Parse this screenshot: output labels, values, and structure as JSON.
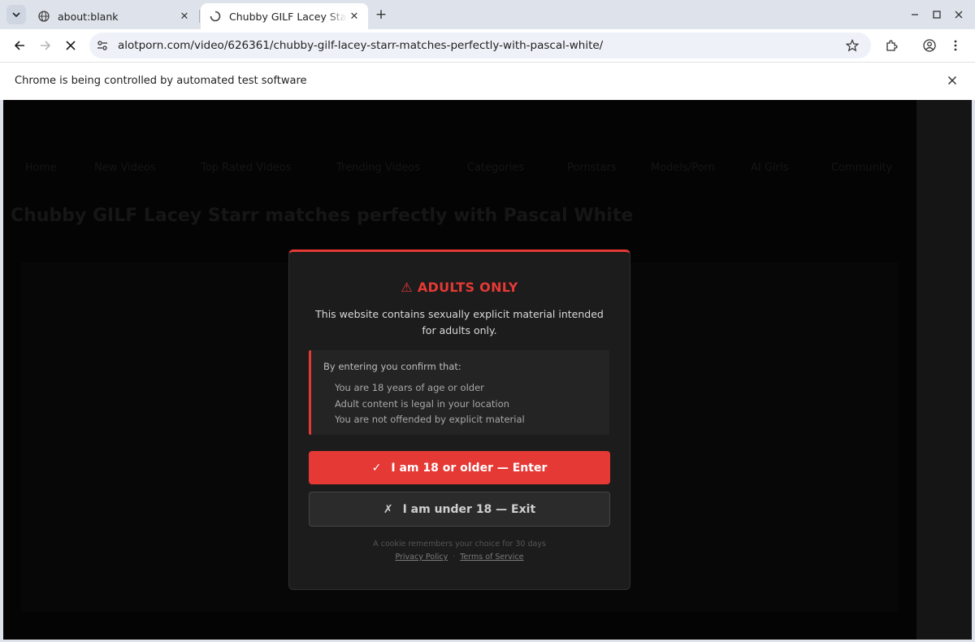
{
  "browser": {
    "tabs": [
      {
        "title": "about:blank",
        "favicon": "globe-icon",
        "active": false
      },
      {
        "title": "Chubby GILF Lacey Starr matches perfectly with Pascal White",
        "favicon": "loading-icon",
        "active": true
      }
    ],
    "url": "alotporn.com/video/626361/chubby-gilf-lacey-starr-matches-perfectly-with-pascal-white/",
    "infobar_message": "Chrome is being controlled by automated test software"
  },
  "page": {
    "nav": [
      "Home",
      "New Videos",
      "Top Rated Videos",
      "Trending Videos",
      "Categories",
      "Pornstars",
      "Models/Porn",
      "AI Girls",
      "Community"
    ],
    "title": "Chubby GILF Lacey Starr matches perfectly with Pascal White"
  },
  "age_gate": {
    "title": "⚠ ADULTS ONLY",
    "description": "This website contains sexually explicit material intended for adults only.",
    "confirm_intro": "By entering you confirm that:",
    "confirm_items": [
      "You are 18 years of age or older",
      "Adult content is legal in your location",
      "You are not offended by explicit material"
    ],
    "enter_icon": "✓",
    "enter_label": "I am 18 or older — Enter",
    "exit_icon": "✗",
    "exit_label": "I am under 18 — Exit",
    "cookie_note": "A cookie remembers your choice for 30 days",
    "privacy_link": "Privacy Policy",
    "link_separator": "·",
    "terms_link": "Terms of Service"
  },
  "colors": {
    "accent": "#e53935",
    "modal_bg": "#1c1c1c"
  }
}
